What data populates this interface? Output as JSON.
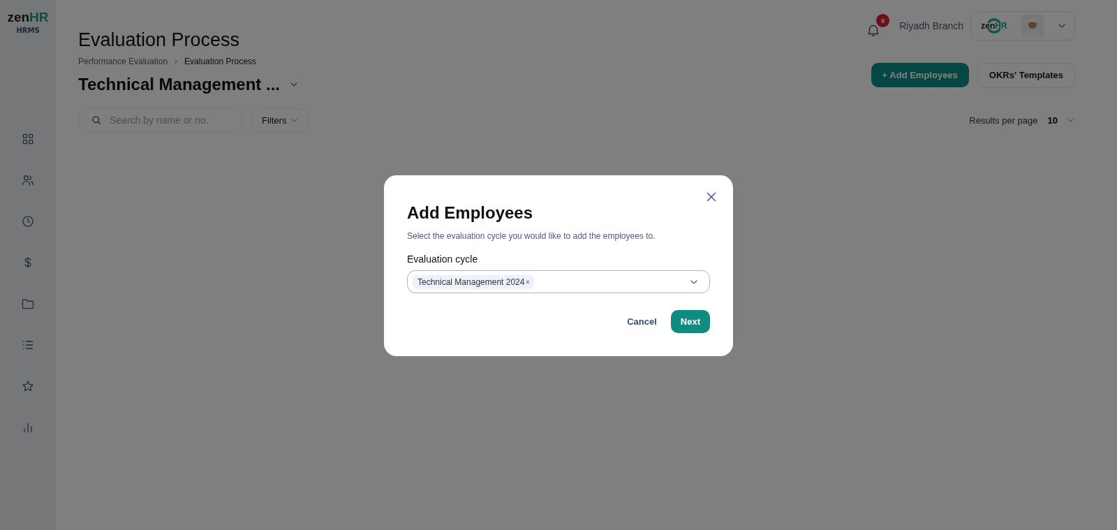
{
  "sidebar": {
    "logo": {
      "part_1": "zen",
      "part_2": "HR"
    },
    "product": "HRMS",
    "nav": [
      {
        "kind": "grid"
      },
      {
        "kind": "people"
      },
      {
        "kind": "clock"
      },
      {
        "kind": "dollar"
      },
      {
        "kind": "folder"
      },
      {
        "kind": "list"
      },
      {
        "kind": "star"
      },
      {
        "kind": "chart"
      }
    ]
  },
  "header": {
    "notification_count": "9",
    "branch": "Riyadh Branch",
    "company_logo": {
      "part_1": "zen",
      "part_2": "HR"
    }
  },
  "page": {
    "title": "Evaluation Process",
    "breadcrumb": [
      "Performance Evaluation",
      "Evaluation Process"
    ],
    "cycle_title": "Technical Management ...",
    "buttons": [
      {
        "kind": "primary",
        "label": "+ Add Employees"
      },
      {
        "kind": "secondary",
        "label": "OKRs' Templates"
      }
    ],
    "search": {
      "placeholder": "Search by name or no."
    },
    "filters": "Filters",
    "results_per_page": {
      "label": "Results per page",
      "value": "10"
    }
  },
  "modal": {
    "title": "Add Employees",
    "description": "Select the evaluation cycle you would like to add the employees to.",
    "field_label": "Evaluation cycle",
    "selected_tags": [
      "Technical Management 2024"
    ],
    "buttons": [
      {
        "kind": "link",
        "label": "Cancel"
      },
      {
        "kind": "primary",
        "label": "Next"
      }
    ]
  }
}
